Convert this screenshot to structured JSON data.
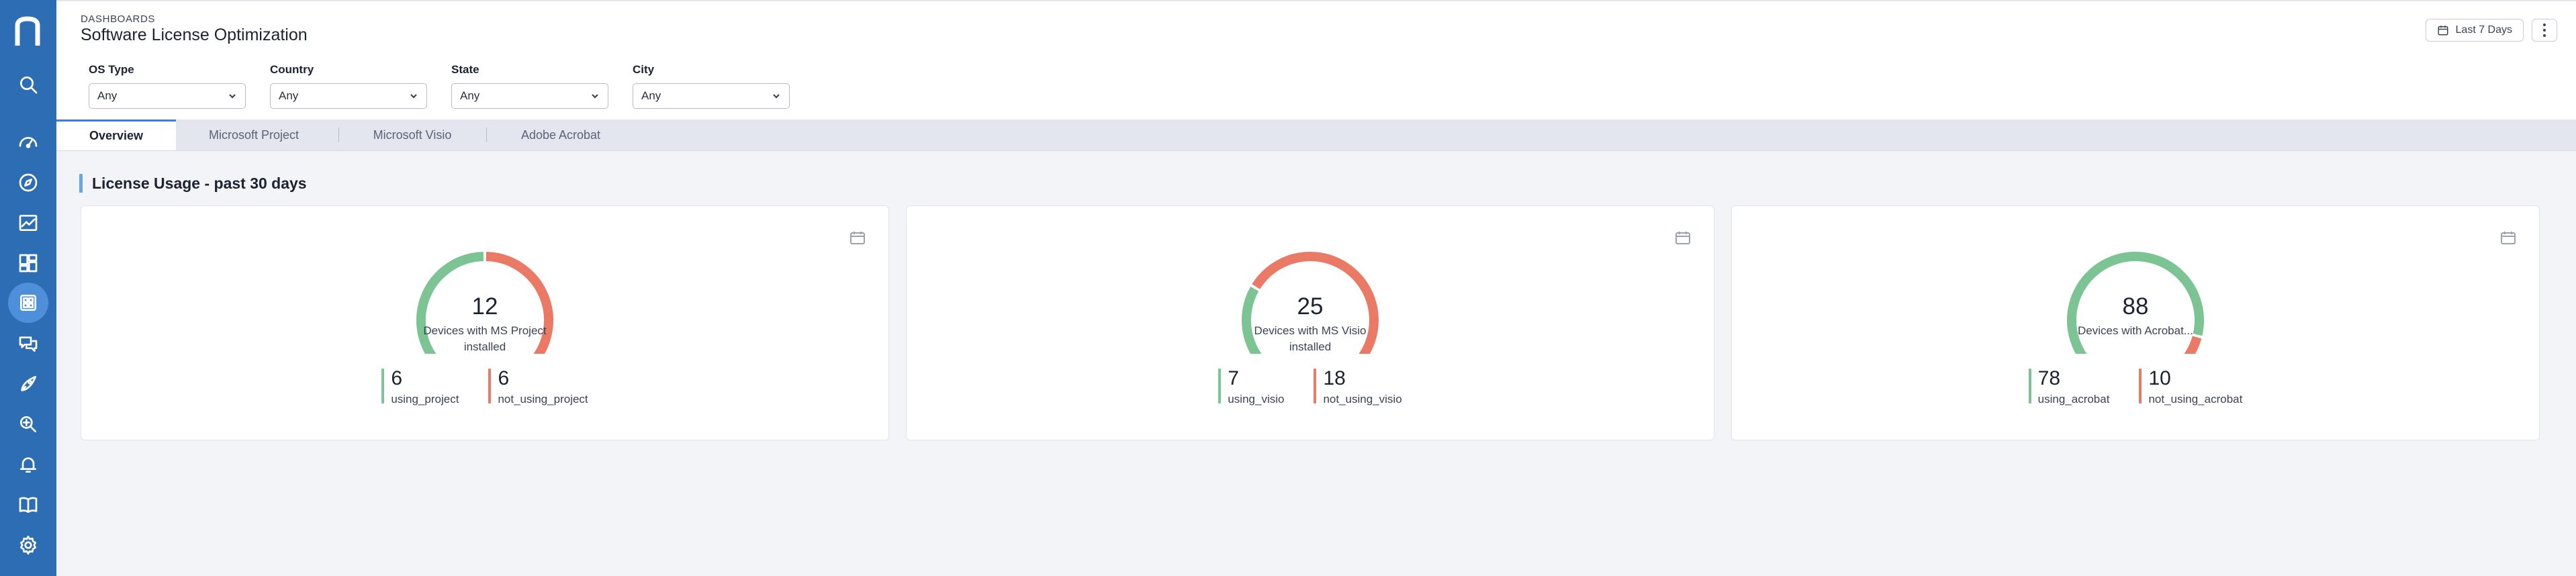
{
  "header": {
    "breadcrumb": "DASHBOARDS",
    "title": "Software License Optimization",
    "date_range": "Last 7 Days"
  },
  "filters": [
    {
      "label": "OS Type",
      "value": "Any"
    },
    {
      "label": "Country",
      "value": "Any"
    },
    {
      "label": "State",
      "value": "Any"
    },
    {
      "label": "City",
      "value": "Any"
    }
  ],
  "tabs": [
    {
      "label": "Overview",
      "active": true
    },
    {
      "label": "Microsoft Project",
      "active": false
    },
    {
      "label": "Microsoft Visio",
      "active": false
    },
    {
      "label": "Adobe Acrobat",
      "active": false
    }
  ],
  "section": {
    "title": "License Usage - past 30 days"
  },
  "colors": {
    "sidebar": "#2c6db3",
    "used": "#7cc493",
    "unused": "#ea7a66",
    "accent": "#3c7fd0"
  },
  "sidebar_icons": [
    "search-icon",
    "speedometer-icon",
    "compass-icon",
    "chart-icon",
    "dashboard-icon",
    "apps-icon",
    "chat-icon",
    "rocket-icon",
    "investigate-icon",
    "bell-icon",
    "book-icon",
    "gear-icon"
  ],
  "chart_data": [
    {
      "type": "pie",
      "total": 12,
      "center_label": "Devices with MS Project installed",
      "series": [
        {
          "name": "using_project",
          "value": 6
        },
        {
          "name": "not_using_project",
          "value": 6
        }
      ]
    },
    {
      "type": "pie",
      "total": 25,
      "center_label": "Devices with MS Visio installed",
      "series": [
        {
          "name": "using_visio",
          "value": 7
        },
        {
          "name": "not_using_visio",
          "value": 18
        }
      ]
    },
    {
      "type": "pie",
      "total": 88,
      "center_label": "Devices with Acrobat...",
      "series": [
        {
          "name": "using_acrobat",
          "value": 78
        },
        {
          "name": "not_using_acrobat",
          "value": 10
        }
      ]
    }
  ]
}
